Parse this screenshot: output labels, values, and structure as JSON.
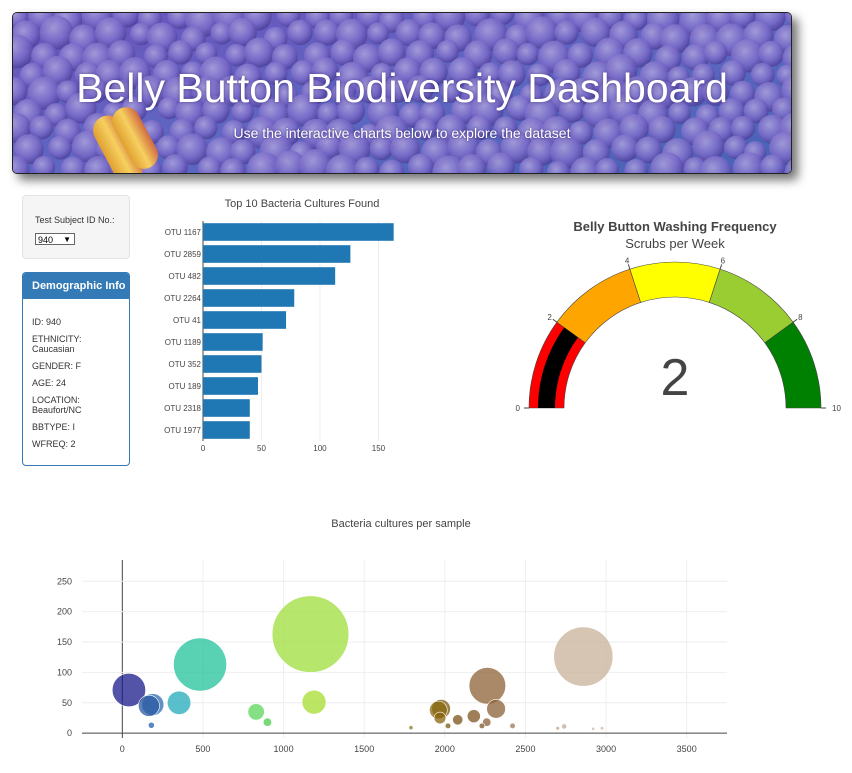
{
  "header": {
    "title": "Belly Button Biodiversity Dashboard",
    "subtitle": "Use the interactive charts below to explore the dataset"
  },
  "selector": {
    "label": "Test Subject ID No.:",
    "selected": "940"
  },
  "demographics": {
    "heading": "Demographic Info",
    "rows": [
      "ID: 940",
      "ETHNICITY: Caucasian",
      "GENDER: F",
      "AGE: 24",
      "LOCATION: Beaufort/NC",
      "BBTYPE: I",
      "WFREQ: 2"
    ]
  },
  "colors": {
    "bar": "#1f77b4",
    "panel": "#337ab7",
    "gauge_steps": [
      "#ff0000",
      "#ffa500",
      "#ffff00",
      "#9acd32",
      "#008000"
    ],
    "needle": "#000000"
  },
  "chart_data": [
    {
      "type": "bar",
      "orientation": "horizontal",
      "title": "Top 10 Bacteria Cultures Found",
      "categories": [
        "OTU 1167",
        "OTU 2859",
        "OTU 482",
        "OTU 2264",
        "OTU 41",
        "OTU 1189",
        "OTU 352",
        "OTU 189",
        "OTU 2318",
        "OTU 1977"
      ],
      "values": [
        163,
        126,
        113,
        78,
        71,
        51,
        50,
        47,
        40,
        40
      ],
      "xlim": [
        0,
        165
      ],
      "xticks": [
        0,
        50,
        100,
        150
      ]
    },
    {
      "type": "gauge",
      "title": "Belly Button Washing Frequency",
      "subtitle": "Scrubs per Week",
      "value": 2,
      "range": [
        0,
        10
      ],
      "ticks": [
        0,
        2,
        4,
        6,
        8,
        10
      ],
      "steps": [
        [
          0,
          2
        ],
        [
          2,
          4
        ],
        [
          4,
          6
        ],
        [
          6,
          8
        ],
        [
          8,
          10
        ]
      ]
    },
    {
      "type": "scatter",
      "subtype": "bubble",
      "title": "Bacteria cultures per sample",
      "xlim": [
        -250,
        3750
      ],
      "ylim": [
        -8,
        285
      ],
      "xticks": [
        0,
        500,
        1000,
        1500,
        2000,
        2500,
        3000,
        3500
      ],
      "yticks": [
        0,
        50,
        100,
        150,
        200,
        250
      ],
      "grid": true,
      "points": [
        {
          "x": 41,
          "y": 71,
          "size": 71,
          "color": "#1a1a8a"
        },
        {
          "x": 165,
          "y": 45,
          "size": 45,
          "color": "#2a5aa0"
        },
        {
          "x": 180,
          "y": 13,
          "size": 13,
          "color": "#1f5fb0"
        },
        {
          "x": 189,
          "y": 47,
          "size": 47,
          "color": "#2e6bb2"
        },
        {
          "x": 352,
          "y": 50,
          "size": 50,
          "color": "#22aaba"
        },
        {
          "x": 482,
          "y": 113,
          "size": 113,
          "color": "#22c29a"
        },
        {
          "x": 830,
          "y": 35,
          "size": 35,
          "color": "#5cd65c"
        },
        {
          "x": 900,
          "y": 18,
          "size": 18,
          "color": "#4ccc4c"
        },
        {
          "x": 1167,
          "y": 163,
          "size": 163,
          "color": "#9ede3a"
        },
        {
          "x": 1189,
          "y": 51,
          "size": 51,
          "color": "#a5dc30"
        },
        {
          "x": 1790,
          "y": 9,
          "size": 9,
          "color": "#8a7a20"
        },
        {
          "x": 1960,
          "y": 38,
          "size": 38,
          "color": "#8a6a10"
        },
        {
          "x": 1970,
          "y": 25,
          "size": 25,
          "color": "#8a6510"
        },
        {
          "x": 1977,
          "y": 40,
          "size": 40,
          "color": "#7a5c10"
        },
        {
          "x": 2020,
          "y": 12,
          "size": 12,
          "color": "#7a5a15"
        },
        {
          "x": 2080,
          "y": 22,
          "size": 22,
          "color": "#7a5418"
        },
        {
          "x": 2180,
          "y": 28,
          "size": 28,
          "color": "#7d5420"
        },
        {
          "x": 2230,
          "y": 12,
          "size": 12,
          "color": "#7d5425"
        },
        {
          "x": 2264,
          "y": 78,
          "size": 78,
          "color": "#8e6235"
        },
        {
          "x": 2318,
          "y": 40,
          "size": 40,
          "color": "#8a6035"
        },
        {
          "x": 2260,
          "y": 18,
          "size": 18,
          "color": "#8a6038"
        },
        {
          "x": 2420,
          "y": 12,
          "size": 12,
          "color": "#a0785a"
        },
        {
          "x": 2700,
          "y": 8,
          "size": 8,
          "color": "#c0a088"
        },
        {
          "x": 2740,
          "y": 11,
          "size": 11,
          "color": "#c4a890"
        },
        {
          "x": 2859,
          "y": 126,
          "size": 126,
          "color": "#c9b19a"
        },
        {
          "x": 2920,
          "y": 7,
          "size": 7,
          "color": "#cfb9a6"
        },
        {
          "x": 2975,
          "y": 8,
          "size": 8,
          "color": "#d2c0ae"
        }
      ]
    }
  ]
}
